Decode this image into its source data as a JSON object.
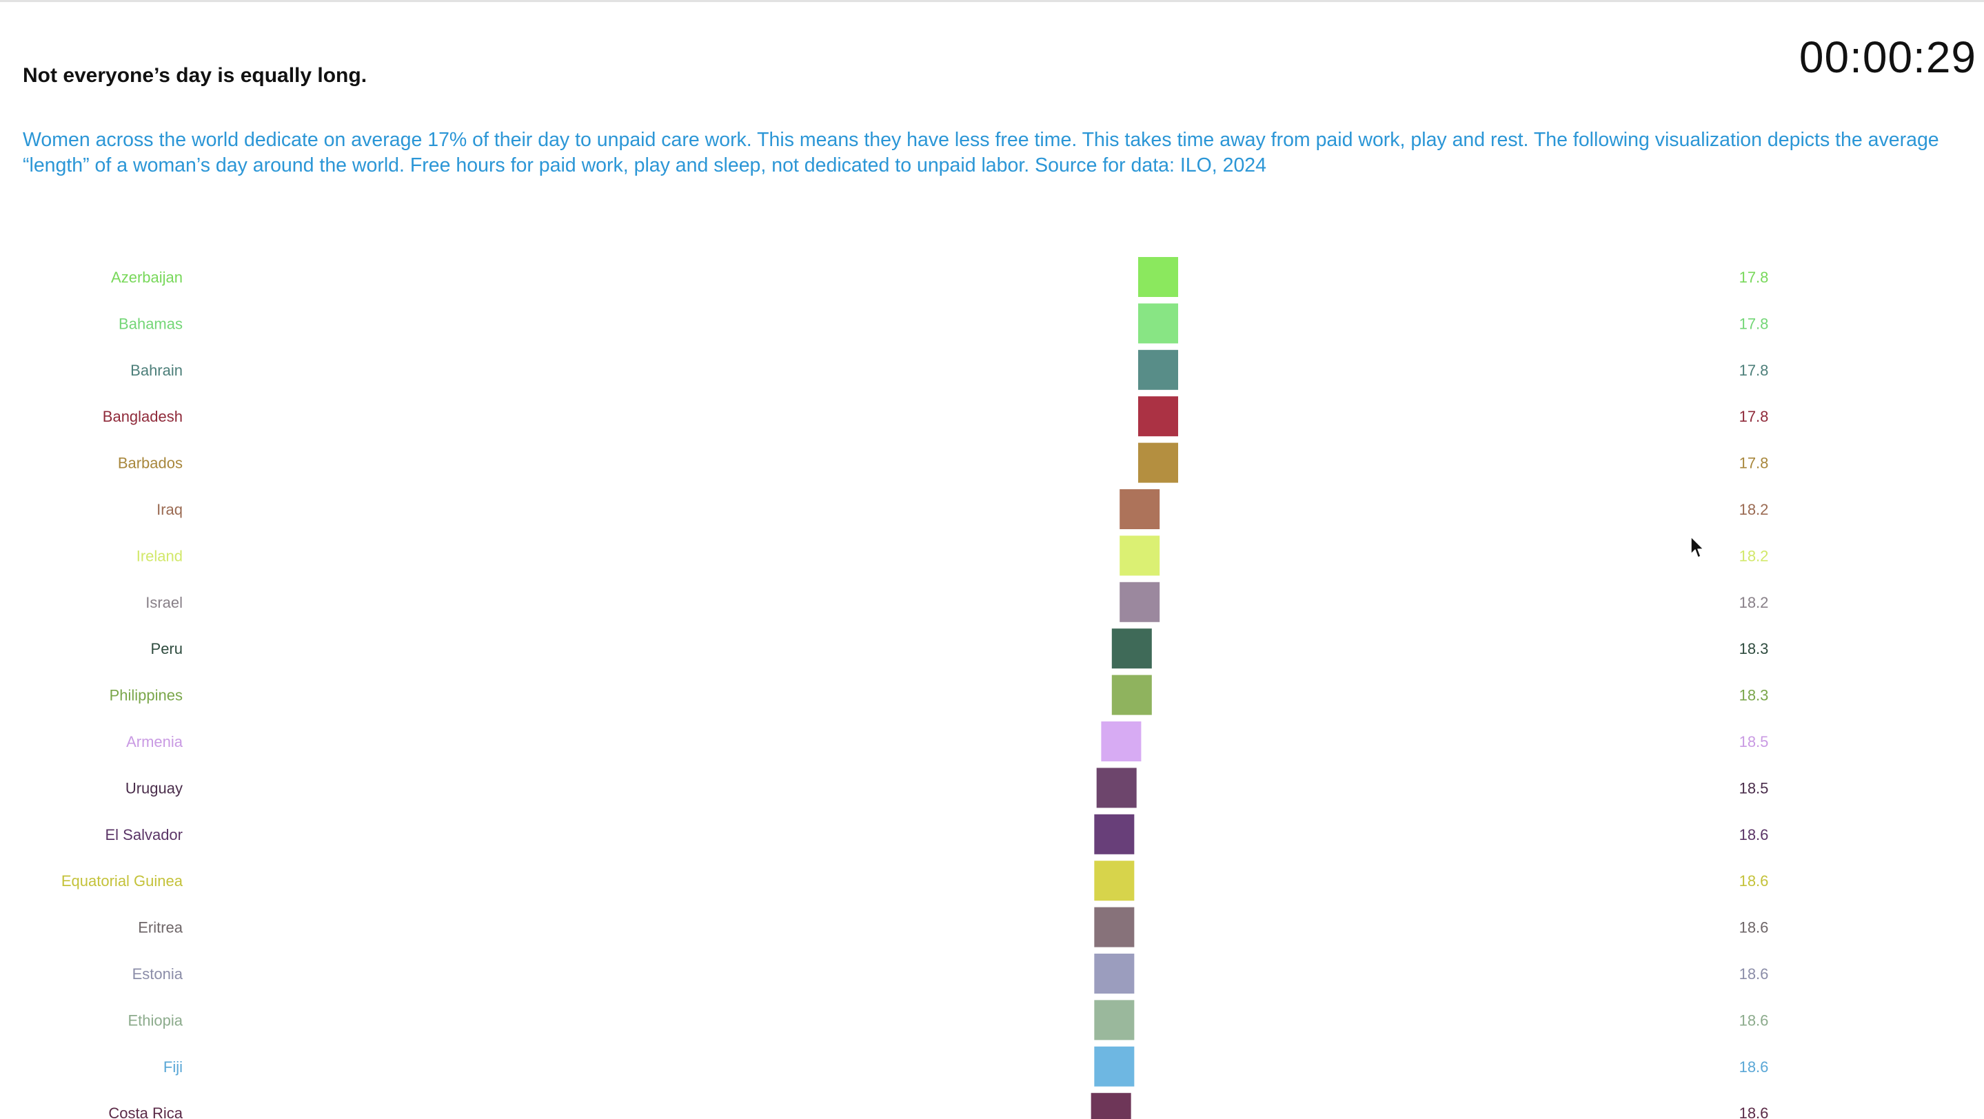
{
  "headline": "Not everyone’s day is equally long.",
  "timer": "00:00:29",
  "description": "Women across the world dedicate on average 17% of their day to unpaid care work. This means they have less free time. This takes time away from paid work, play and rest. The following visualization depicts the average “length” of a woman’s day around the world. Free hours for paid work, play and sleep, not dedicated to unpaid labor. Source for data: ILO, 2024",
  "colors": {
    "description_text": "#2b96d6",
    "headline_text": "#111111"
  },
  "chart_data": {
    "type": "bar",
    "value_label_format": "one decimal",
    "categories": [
      "Azerbaijan",
      "Bahamas",
      "Bahrain",
      "Bangladesh",
      "Barbados",
      "Iraq",
      "Ireland",
      "Israel",
      "Peru",
      "Philippines",
      "Armenia",
      "Uruguay",
      "El Salvador",
      "Equatorial Guinea",
      "Eritrea",
      "Estonia",
      "Ethiopia",
      "Fiji",
      "Costa Rica"
    ],
    "values": [
      17.8,
      17.8,
      17.8,
      17.8,
      17.8,
      18.2,
      18.2,
      18.2,
      18.3,
      18.3,
      18.5,
      18.5,
      18.6,
      18.6,
      18.6,
      18.6,
      18.6,
      18.6,
      18.6
    ],
    "marker_values": [
      17.8,
      17.8,
      17.8,
      17.8,
      17.8,
      18.2,
      18.2,
      18.2,
      18.37,
      18.37,
      18.6,
      18.7,
      18.75,
      18.75,
      18.75,
      18.75,
      18.75,
      18.75,
      18.82
    ],
    "marker_colors": [
      "#8be85e",
      "#88e584",
      "#588d88",
      "#ab3244",
      "#b48f40",
      "#ad735a",
      "#dbf073",
      "#9b889e",
      "#3f6a58",
      "#8fb35e",
      "#d7abf3",
      "#6d456c",
      "#683f79",
      "#d7d44b",
      "#87727a",
      "#9b9dbe",
      "#9ab89c",
      "#6eb7e2",
      "#6e3658"
    ],
    "label_colors": [
      "#78d85a",
      "#73d676",
      "#4d7f7a",
      "#8f2a3a",
      "#a8873c",
      "#9a6a52",
      "#d2e86a",
      "#888088",
      "#2e4b3e",
      "#7aa64a",
      "#c99ae3",
      "#4a2d4b",
      "#5a3466",
      "#c4c23a",
      "#6e6668",
      "#8b8da8",
      "#8cab8c",
      "#5aa7d6",
      "#5a2a47"
    ],
    "x_direction": "reversed"
  }
}
